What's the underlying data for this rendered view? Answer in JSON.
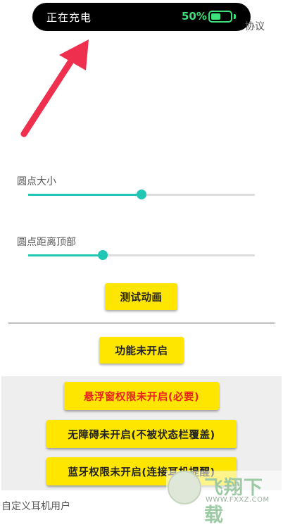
{
  "status_pill": {
    "label": "正在充电",
    "percent": "50%",
    "battery_level": 0.5
  },
  "header": {
    "agreement_partial": "协议"
  },
  "sliders": [
    {
      "label": "圆点大小",
      "value": 0.5
    },
    {
      "label": "圆点距离顶部",
      "value": 0.33
    }
  ],
  "buttons": {
    "test_animation": "测试动画",
    "feature_status": "功能未开启",
    "overlay_permission": "悬浮窗权限未开启(必要)",
    "accessibility": "无障碍未开启(不被状态栏覆盖)",
    "bluetooth_permission": "蓝牙权限未开启(连接耳机提醒)"
  },
  "footer": {
    "custom_earphone_user": "自定义耳机用户"
  },
  "watermark": {
    "title": "飞翔下载",
    "url": "WWW.FXXZ.COM"
  },
  "colors": {
    "accent": "#1fc7b4",
    "button_yellow": "#ffe600",
    "warning_red": "#e8231f",
    "battery_green": "#3ee27a",
    "arrow_red": "#ee2f4d"
  },
  "icons": {
    "arrow": "red-arrow-icon",
    "battery": "battery-icon",
    "logo": "watermark-logo-icon"
  }
}
